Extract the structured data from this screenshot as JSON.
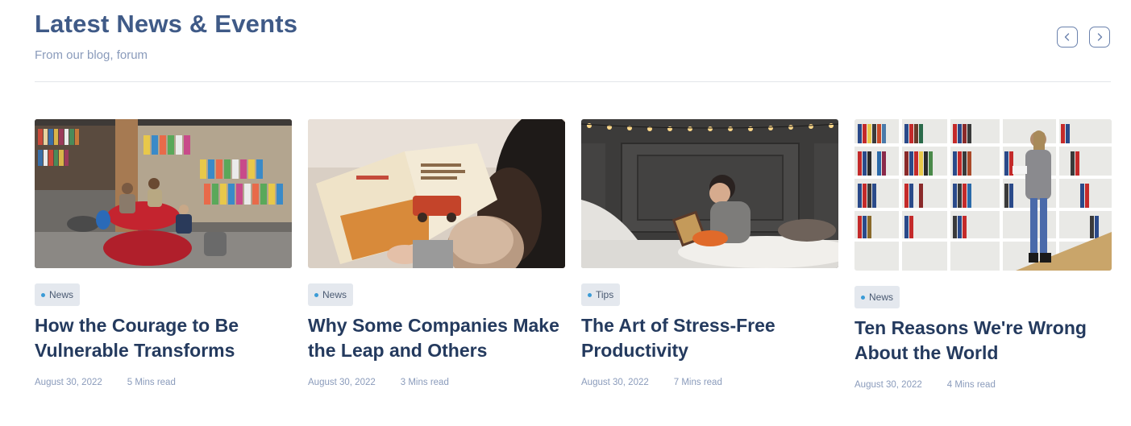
{
  "header": {
    "title": "Latest News & Events",
    "subtitle": "From our blog, forum"
  },
  "nav": {
    "prev_icon": "chevron-left-icon",
    "next_icon": "chevron-right-icon"
  },
  "colors": {
    "title": "#3f5a87",
    "card_title": "#243a5e",
    "muted": "#8a9bbb",
    "badge_bg": "#e4e8ee",
    "badge_dot": "#3b9bd6"
  },
  "cards": [
    {
      "category": "News",
      "title": "How the Courage to Be Vulnerable Transforms",
      "date": "August 30, 2022",
      "read_time": "5 Mins read"
    },
    {
      "category": "News",
      "title": "Why Some Companies Make the Leap and Others",
      "date": "August 30, 2022",
      "read_time": "3 Mins read"
    },
    {
      "category": "Tips",
      "title": "The Art of Stress-Free Productivity",
      "date": "August 30, 2022",
      "read_time": "7 Mins read"
    },
    {
      "category": "News",
      "title": "Ten Reasons We're Wrong About the World",
      "date": "August 30, 2022",
      "read_time": "4 Mins read"
    }
  ]
}
